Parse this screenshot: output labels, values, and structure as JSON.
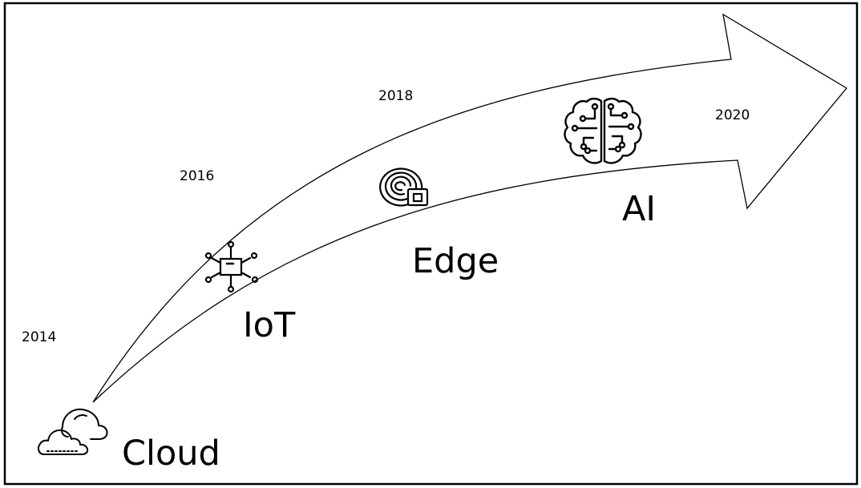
{
  "years": {
    "y2014": "2014",
    "y2016": "2016",
    "y2018": "2018",
    "y2020": "2020"
  },
  "stages": {
    "cloud": "Cloud",
    "iot": "IoT",
    "edge": "Edge",
    "ai": "AI"
  },
  "icons": {
    "cloud": "cloud-icon",
    "iot": "iot-chip-icon",
    "edge": "edge-device-icon",
    "ai": "brain-circuit-icon"
  },
  "colors": {
    "stroke": "#000000",
    "background": "#ffffff"
  }
}
